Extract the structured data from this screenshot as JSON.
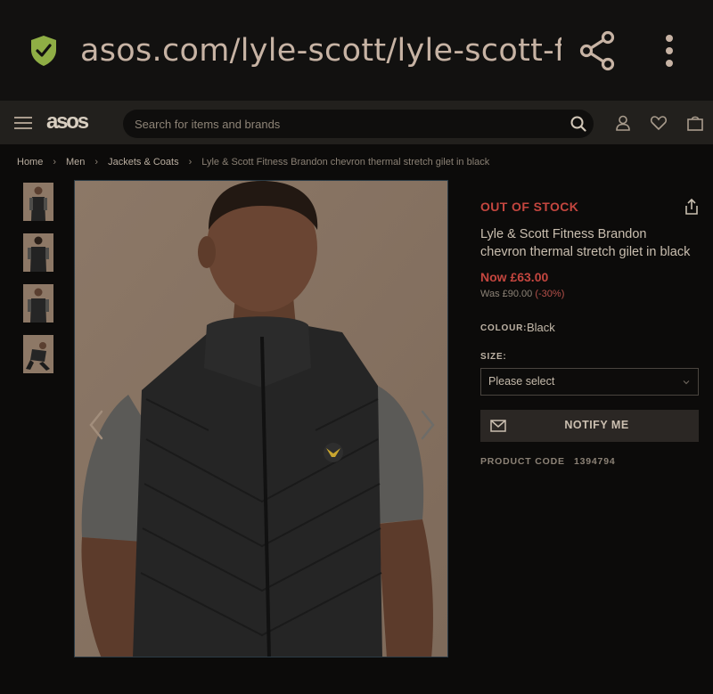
{
  "browser": {
    "url": "asos.com/lyle-scott/lyle-scott-fitness-brandon-chevron-thermal-stretch-gilet-in-black"
  },
  "header": {
    "logo": "asos",
    "search_placeholder": "Search for items and brands"
  },
  "breadcrumb": [
    "Home",
    "Men",
    "Jackets & Coats",
    "Lyle & Scott Fitness Brandon chevron thermal stretch gilet in black"
  ],
  "breadcrumb_separator": "›",
  "product": {
    "stock_status": "OUT OF STOCK",
    "title": "Lyle & Scott Fitness Brandon chevron thermal stretch gilet in black",
    "price_now": "Now £63.00",
    "price_was": "Was £90.00",
    "discount": "(-30%)",
    "colour_label": "COLOUR:",
    "colour_value": "Black",
    "size_label": "SIZE:",
    "size_selected": "Please select",
    "notify_label": "NOTIFY ME",
    "product_code_label": "PRODUCT CODE",
    "product_code": "1394794"
  },
  "colors": {
    "accent_red": "#c4463f",
    "background": "#0c0b0a",
    "header_bar": "#22201d",
    "shield_green": "#8fae45"
  }
}
